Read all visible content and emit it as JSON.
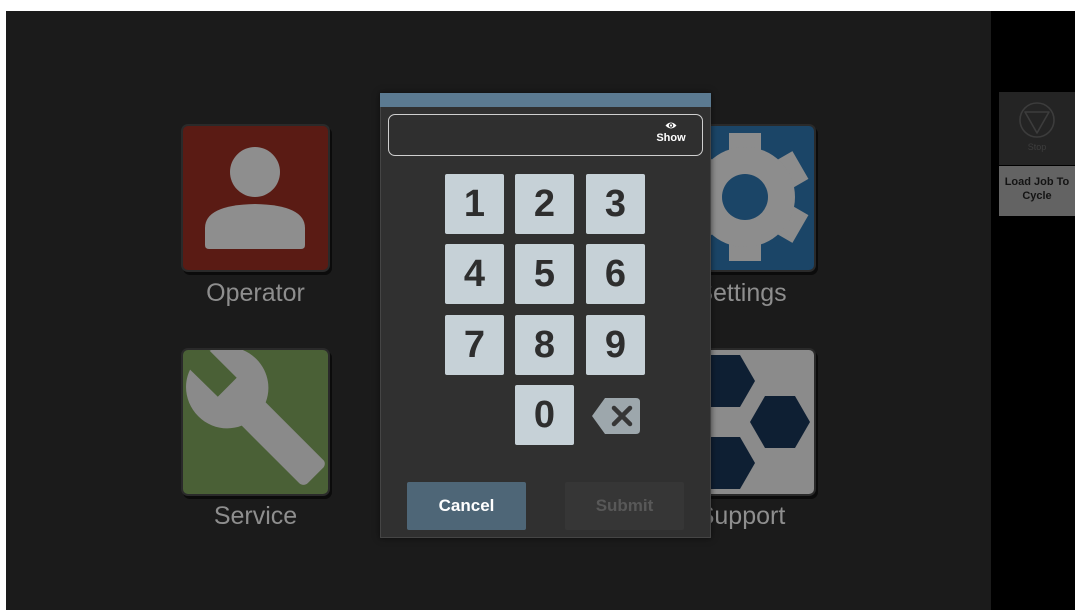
{
  "tiles": [
    {
      "label": "Operator",
      "color": "#5a1b14",
      "icon": "person-icon"
    },
    {
      "label": "Settings",
      "color": "#1b4567",
      "icon": "gear-icon"
    },
    {
      "label": "Service",
      "color": "#4a6036",
      "icon": "wrench-icon"
    },
    {
      "label": "Support",
      "color": "#8b8b8b",
      "icon": "hexagons-icon"
    }
  ],
  "side_panel": {
    "stop": {
      "label": "Stop",
      "icon": "stop-icon",
      "color": "#242424"
    },
    "load_job": {
      "label": "Load Job To Cycle",
      "color": "#636363"
    }
  },
  "pin_dialog": {
    "header_color": "#5b7a91",
    "input": {
      "value": ""
    },
    "show_toggle": {
      "label": "Show",
      "icon": "eye-icon"
    },
    "keys": [
      "1",
      "2",
      "3",
      "4",
      "5",
      "6",
      "7",
      "8",
      "9",
      "0"
    ],
    "backspace": {
      "icon": "backspace-icon"
    },
    "cancel": {
      "label": "Cancel",
      "color": "#4e6677"
    },
    "submit": {
      "label": "Submit",
      "color": "#363636",
      "enabled": false
    }
  }
}
